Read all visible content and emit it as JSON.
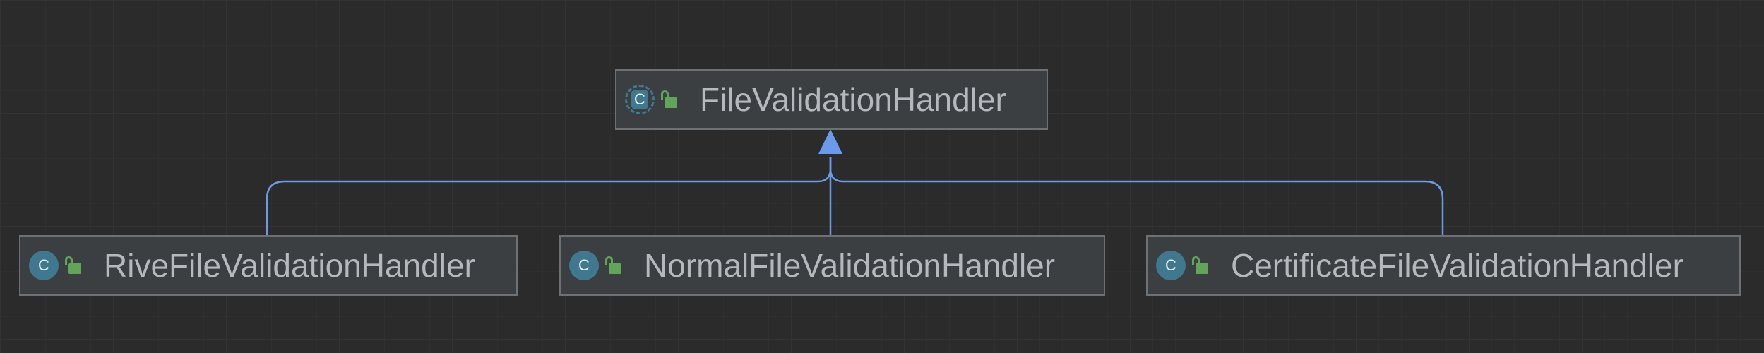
{
  "diagram": {
    "type": "uml-class-hierarchy",
    "parent": {
      "name": "FileValidationHandler",
      "kind": "abstract-class",
      "icon": "abstract-class-icon",
      "visibility_icon": "public-unlocked-icon"
    },
    "children": [
      {
        "name": "RiveFileValidationHandler",
        "kind": "class",
        "icon": "class-icon",
        "visibility_icon": "public-unlocked-icon"
      },
      {
        "name": "NormalFileValidationHandler",
        "kind": "class",
        "icon": "class-icon",
        "visibility_icon": "public-unlocked-icon"
      },
      {
        "name": "CertificateFileValidationHandler",
        "kind": "class",
        "icon": "class-icon",
        "visibility_icon": "public-unlocked-icon"
      }
    ],
    "relation": "extends",
    "icon_letter": "C"
  },
  "colors": {
    "background": "#2b2b2b",
    "node_fill": "#3c3f41",
    "node_border": "#6e7173",
    "edge": "#6b9ae8",
    "text": "#b4b9bd",
    "class_icon": "#40798f",
    "lock_icon": "#62a45a"
  }
}
